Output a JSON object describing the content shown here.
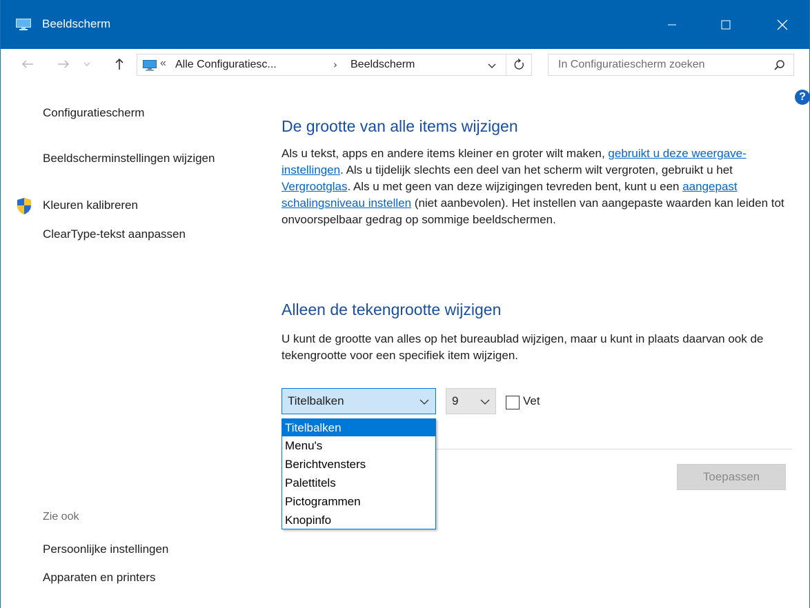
{
  "window": {
    "title": "Beeldscherm",
    "titlebar_color": "#0063b1"
  },
  "address": {
    "prefix": "«",
    "crumb1": "Alle Configuratiesc...",
    "separator": "›",
    "crumb2": "Beeldscherm"
  },
  "search": {
    "placeholder": "In Configuratiescherm zoeken"
  },
  "sidebar": {
    "items": [
      {
        "label": "Configuratiescherm"
      },
      {
        "label": "Beeldscherminstellingen wijzigen"
      },
      {
        "label": "Kleuren kalibreren"
      },
      {
        "label": "ClearType-tekst aanpassen"
      }
    ],
    "see_also_label": "Zie ook",
    "see_also": [
      {
        "label": "Persoonlijke instellingen"
      },
      {
        "label": "Apparaten en printers"
      }
    ]
  },
  "main": {
    "section1": {
      "heading": "De grootte van alle items wijzigen",
      "p1": "Als u tekst, apps en andere items kleiner en groter wilt maken, ",
      "link1": "gebruikt u deze weergave-instellingen",
      "p2": ". Als u tijdelijk slechts een deel van het scherm wilt vergroten, gebruikt u het ",
      "link2": "Vergrootglas",
      "p3": ". Als u met geen van deze wijzigingen tevreden bent, kunt u een ",
      "link3": "aangepast schalingsniveau instellen",
      "p4": " (niet aanbevolen). Het instellen van aangepaste waarden kan leiden tot onvoorspelbaar gedrag op sommige beeldschermen."
    },
    "section2": {
      "heading": "Alleen de tekengrootte wijzigen",
      "text": "U kunt de grootte van alles op het bureaublad wijzigen, maar u kunt in plaats daarvan ook de tekengrootte voor een specifiek item wijzigen."
    },
    "item_select": {
      "value": "Titelbalken",
      "options": [
        "Titelbalken",
        "Menu's",
        "Berichtvensters",
        "Palettitels",
        "Pictogrammen",
        "Knopinfo"
      ]
    },
    "size_select": {
      "value": "9"
    },
    "bold_checkbox": {
      "label": "Vet",
      "checked": false
    },
    "apply_label": "Toepassen"
  }
}
